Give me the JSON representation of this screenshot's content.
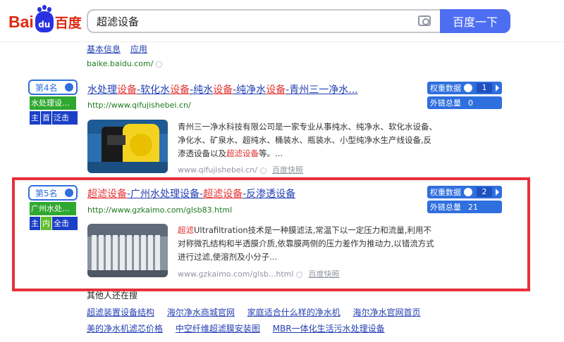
{
  "header": {
    "logo_bai": "Bai",
    "logo_du": "du",
    "logo_cn": "百度",
    "search_value": "超滤设备",
    "search_button": "百度一下"
  },
  "baike": {
    "links": [
      "基本信息",
      "应用"
    ],
    "url": "baike.baidu.com/"
  },
  "results": [
    {
      "rank_label": "第4名",
      "category": "水处理设...",
      "flags": [
        "主",
        "首",
        "泛击中"
      ],
      "title_parts": [
        "水处理",
        "设备",
        "-软化水",
        "设备",
        "-纯水",
        "设备",
        "-纯净水",
        "设备",
        "-青州三一净水..."
      ],
      "url": "http://www.qifujishebei.cn/",
      "snippet_parts": [
        "青州三一净水科技有限公司是一家专业从事纯水、纯净水、软化水设备、净化水、矿泉水、超纯水、桶装水、瓶装水、小型纯净水生产线设备,反渗透设备以及",
        "超滤设备",
        "等。..."
      ],
      "display_url": "www.qifujishebei.cn/",
      "snapshot": "百度快照",
      "weight_label": "权重数据",
      "weight_value": "1",
      "links_label": "外链总量",
      "links_value": "0"
    },
    {
      "rank_label": "第5名",
      "category": "广州水处...",
      "flags": [
        "主",
        "内",
        "全击中"
      ],
      "title_parts": [
        "超滤设备",
        "-广州水处理设备-",
        "超滤设备",
        "-反渗透设备"
      ],
      "url": "http://www.gzkaimo.com/glsb83.html",
      "snippet_parts": [
        "超滤",
        "Ultrafiltration技术是一种膜滤法,常温下以一定压力和流量,利用不对称微孔结构和半透膜介质,依靠膜两侧的压力差作为推动力,以错流方式进行过滤,使溶剂及小分子..."
      ],
      "display_url": "www.gzkaimo.com/glsb...html",
      "snapshot": "百度快照",
      "weight_label": "权重数据",
      "weight_value": "2",
      "links_label": "外链总量",
      "links_value": "21"
    }
  ],
  "related": {
    "heading": "其他人还在搜",
    "row1": [
      "超滤装置设备结构",
      "海尔净水商城官网",
      "家庭适合什么样的净水机",
      "海尔净水官网首页"
    ],
    "row2": [
      "美的净水机滤芯价格",
      "中空纤维超滤膜安装图",
      "MBR一体化生活污水处理设备"
    ]
  },
  "colors": {
    "accent": "#4e6ef2",
    "highlight_border": "#e8303a",
    "keyword_red": "#e53333",
    "url_green": "#1e7a1e"
  }
}
